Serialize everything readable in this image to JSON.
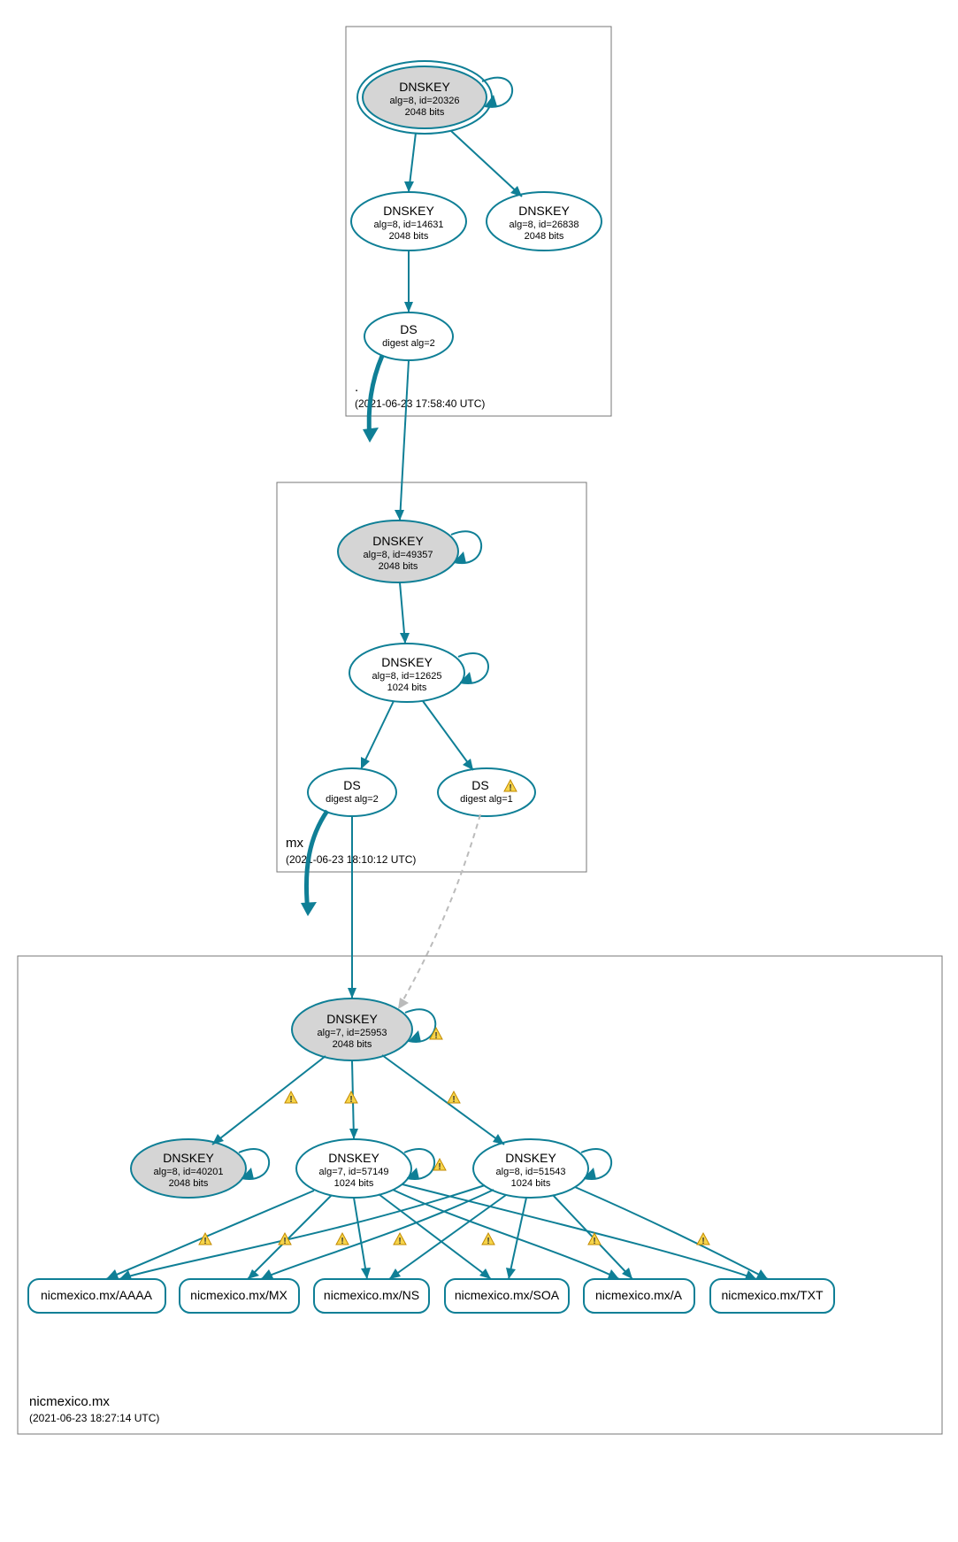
{
  "zones": {
    "root": {
      "label": ".",
      "timestamp": "(2021-06-23 17:58:40 UTC)"
    },
    "mx": {
      "label": "mx",
      "timestamp": "(2021-06-23 18:10:12 UTC)"
    },
    "nic": {
      "label": "nicmexico.mx",
      "timestamp": "(2021-06-23 18:27:14 UTC)"
    }
  },
  "nodes": {
    "root_ksk": {
      "title": "DNSKEY",
      "line1": "alg=8, id=20326",
      "line2": "2048 bits"
    },
    "root_zsk": {
      "title": "DNSKEY",
      "line1": "alg=8, id=14631",
      "line2": "2048 bits"
    },
    "root_key2": {
      "title": "DNSKEY",
      "line1": "alg=8, id=26838",
      "line2": "2048 bits"
    },
    "root_ds": {
      "title": "DS",
      "line1": "digest alg=2"
    },
    "mx_ksk": {
      "title": "DNSKEY",
      "line1": "alg=8, id=49357",
      "line2": "2048 bits"
    },
    "mx_zsk": {
      "title": "DNSKEY",
      "line1": "alg=8, id=12625",
      "line2": "1024 bits"
    },
    "mx_ds1": {
      "title": "DS",
      "line1": "digest alg=2"
    },
    "mx_ds2": {
      "title": "DS",
      "line1": "digest alg=1"
    },
    "nic_ksk": {
      "title": "DNSKEY",
      "line1": "alg=7, id=25953",
      "line2": "2048 bits"
    },
    "nic_key2": {
      "title": "DNSKEY",
      "line1": "alg=8, id=40201",
      "line2": "2048 bits"
    },
    "nic_ziska": {
      "title": "DNSKEY",
      "line1": "alg=7, id=57149",
      "line2": "1024 bits"
    },
    "nic_ziskb": {
      "title": "DNSKEY",
      "line1": "alg=8, id=51543",
      "line2": "1024 bits"
    }
  },
  "rr": {
    "aaaa": "nicmexico.mx/AAAA",
    "mx": "nicmexico.mx/MX",
    "ns": "nicmexico.mx/NS",
    "soa": "nicmexico.mx/SOA",
    "a": "nicmexico.mx/A",
    "txt": "nicmexico.mx/TXT"
  }
}
